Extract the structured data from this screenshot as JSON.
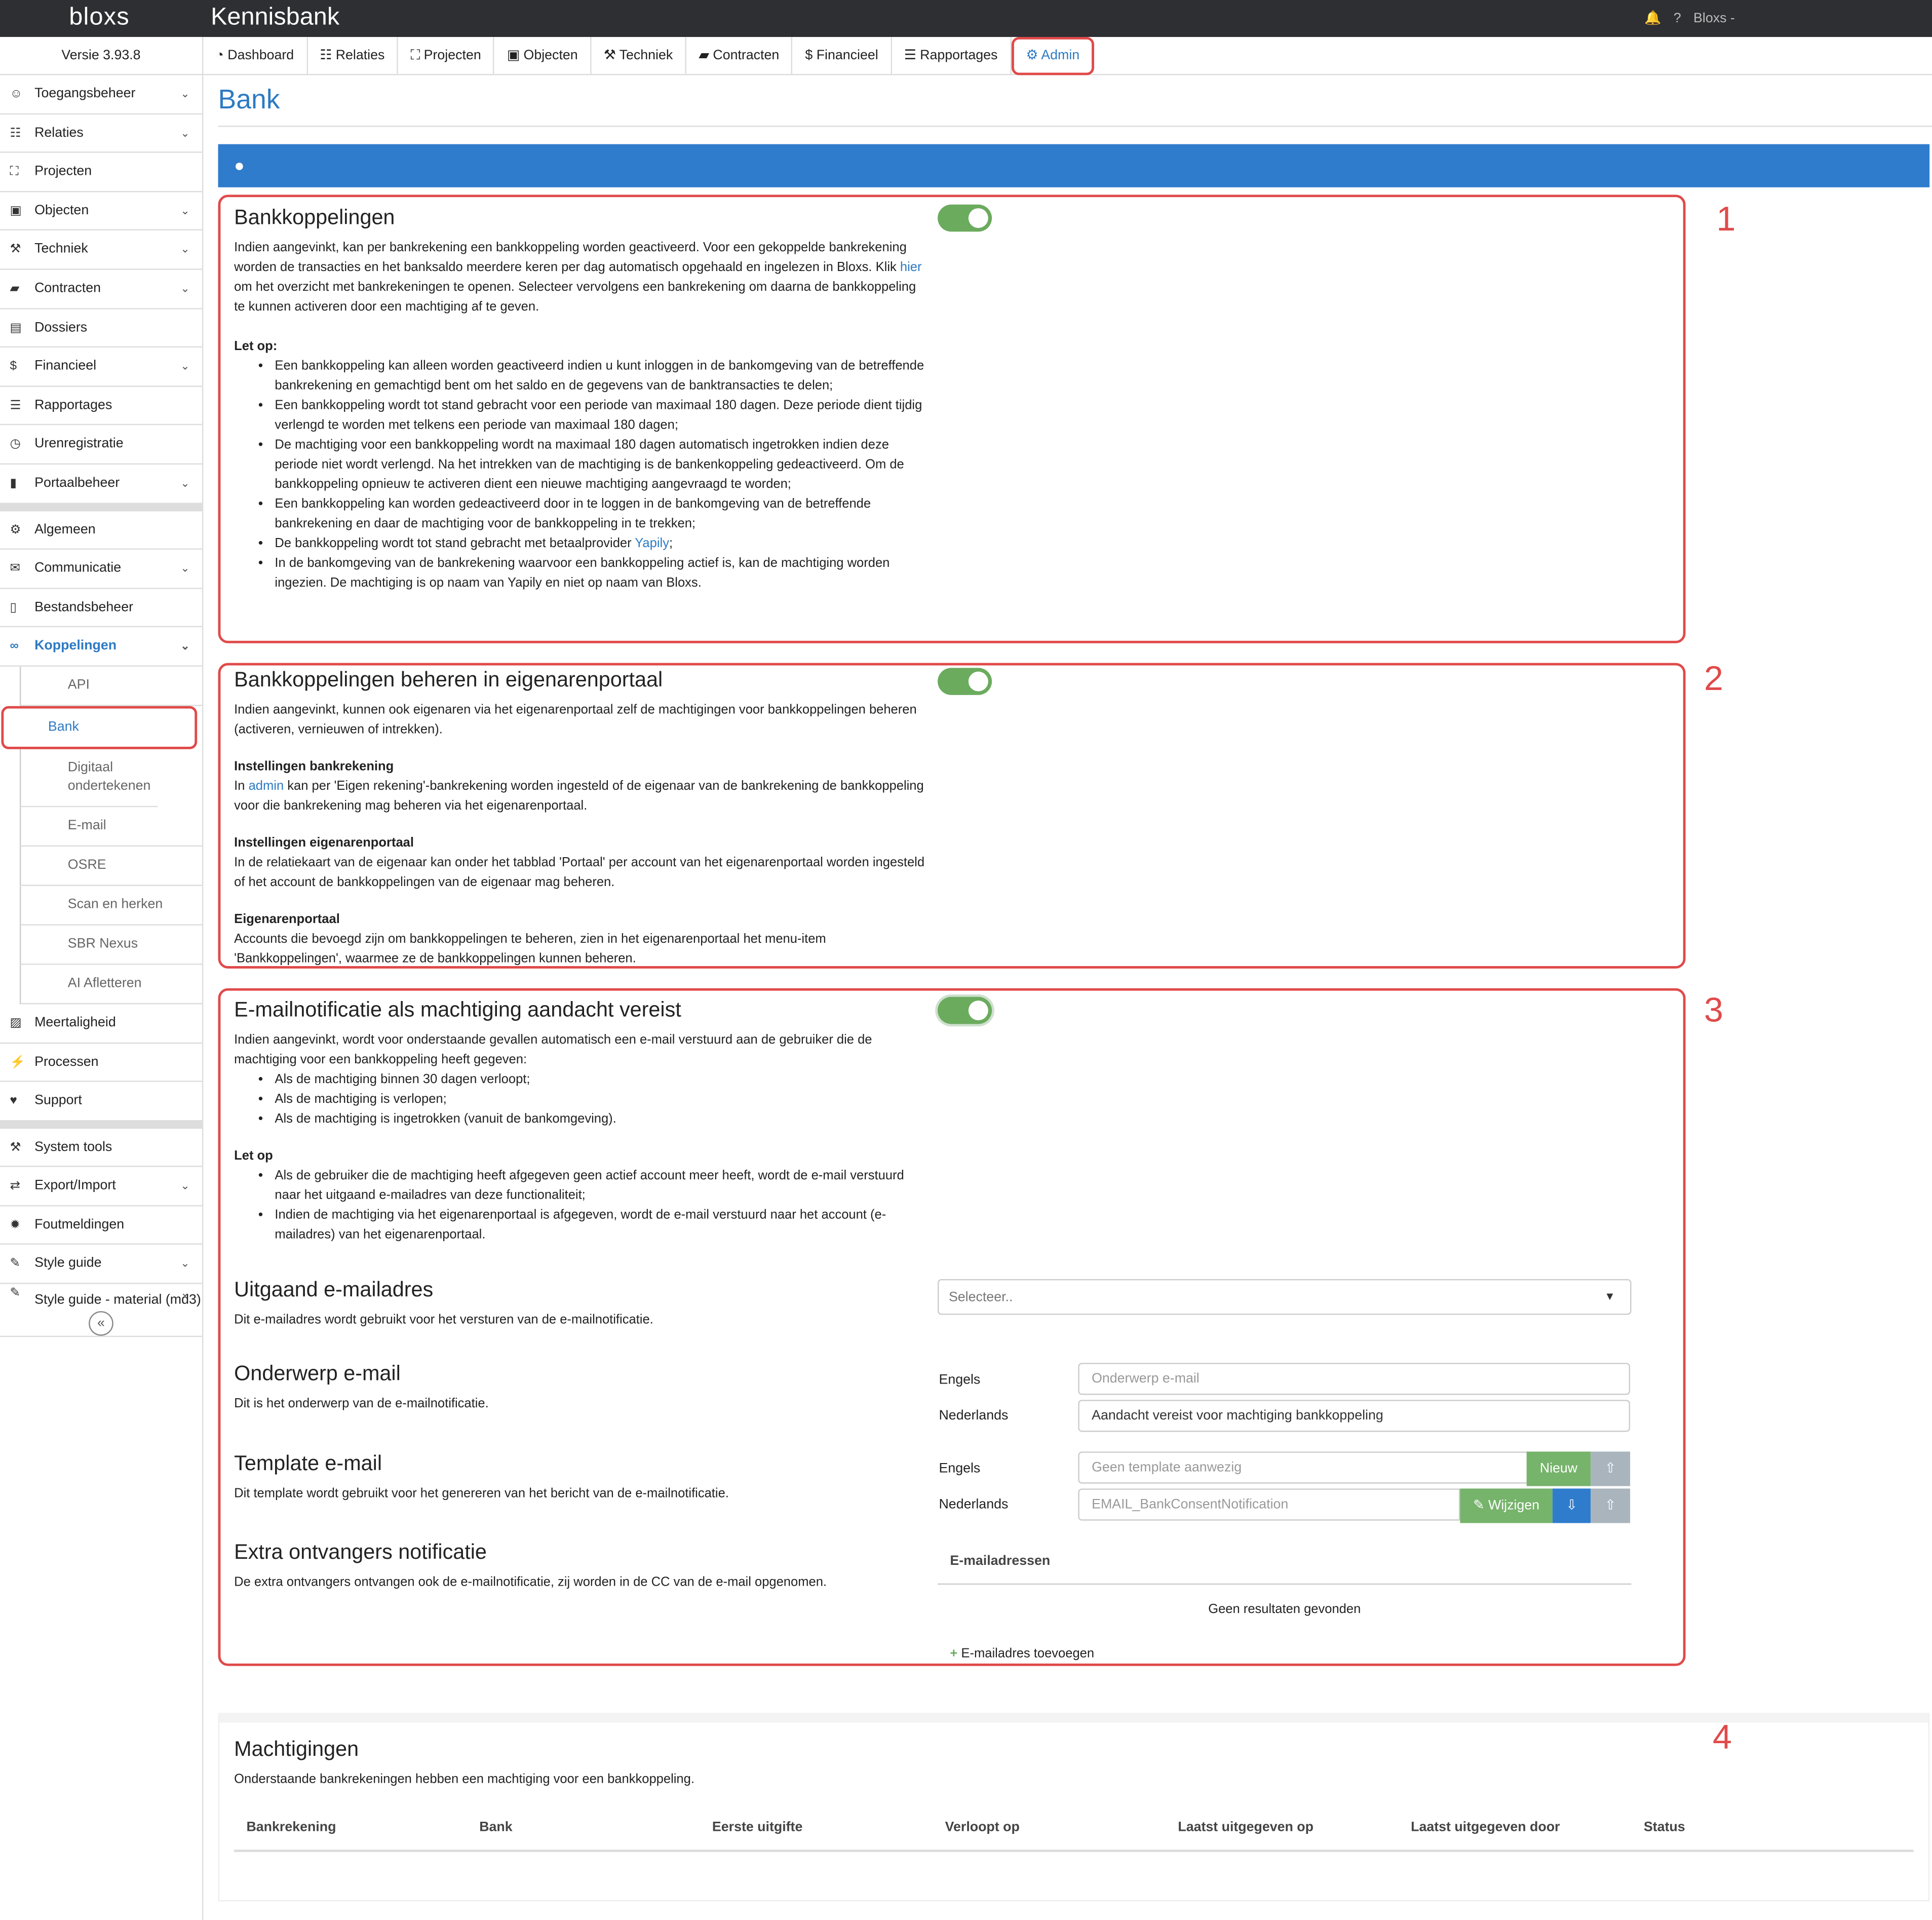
{
  "header": {
    "logo": "bloxs",
    "title": "Kennisbank",
    "bell": "bell-icon",
    "help": "?",
    "user": "Bloxs -"
  },
  "sidebar": {
    "version": "Versie 3.93.8",
    "items": [
      {
        "label": "Toegangsbeheer",
        "icon": "users-icon",
        "chevron": true
      },
      {
        "label": "Relaties",
        "icon": "sitemap-icon",
        "chevron": true
      },
      {
        "label": "Projecten",
        "icon": "expand-icon",
        "chevron": false
      },
      {
        "label": "Objecten",
        "icon": "image-icon",
        "chevron": true
      },
      {
        "label": "Techniek",
        "icon": "tools-icon",
        "chevron": true
      },
      {
        "label": "Contracten",
        "icon": "folder-icon",
        "chevron": true
      },
      {
        "label": "Dossiers",
        "icon": "archive-icon",
        "chevron": false
      },
      {
        "label": "Financieel",
        "icon": "dollar-icon",
        "chevron": true
      },
      {
        "label": "Rapportages",
        "icon": "list-icon",
        "chevron": false
      },
      {
        "label": "Urenregistratie",
        "icon": "clock-icon",
        "chevron": false
      },
      {
        "label": "Portaalbeheer",
        "icon": "bookmark-icon",
        "chevron": true
      }
    ],
    "items2": [
      {
        "label": "Algemeen",
        "icon": "gear-icon",
        "chevron": false
      },
      {
        "label": "Communicatie",
        "icon": "envelope-icon",
        "chevron": true
      },
      {
        "label": "Bestandsbeheer",
        "icon": "file-icon",
        "chevron": false
      },
      {
        "label": "Koppelingen",
        "icon": "link-icon",
        "chevron": true
      }
    ],
    "subitems": [
      "API",
      "Bank",
      "Digitaal ondertekenen",
      "E-mail",
      "OSRE",
      "Scan en herken",
      "SBR Nexus",
      "AI Afletteren"
    ],
    "items3": [
      {
        "label": "Meertaligheid",
        "icon": "language-icon",
        "chevron": false
      },
      {
        "label": "Processen",
        "icon": "bolt-icon",
        "chevron": false
      },
      {
        "label": "Support",
        "icon": "heart-icon",
        "chevron": false
      }
    ],
    "items4": [
      {
        "label": "System tools",
        "icon": "tools-icon",
        "chevron": false
      },
      {
        "label": "Export/Import",
        "icon": "exchange-icon",
        "chevron": true
      },
      {
        "label": "Foutmeldingen",
        "icon": "bug-icon",
        "chevron": false
      },
      {
        "label": "Style guide",
        "icon": "brush-icon",
        "chevron": true
      },
      {
        "label": "Style guide - material (md3)",
        "icon": "brush-icon",
        "chevron": true
      }
    ],
    "collapse": "«"
  },
  "tabs": [
    "Dashboard",
    "Relaties",
    "Projecten",
    "Objecten",
    "Techniek",
    "Contracten",
    "Financieel",
    "Rapportages",
    "Admin"
  ],
  "tab_icons": [
    "dashboard-icon",
    "sitemap-icon",
    "expand-icon",
    "image-icon",
    "tools-icon",
    "folder-icon",
    "dollar-icon",
    "list-icon",
    "gear-icon"
  ],
  "page_title": "Bank",
  "bar_icon": "piggy-bank-icon",
  "annotations": [
    "1",
    "2",
    "3",
    "4"
  ],
  "s1": {
    "title": "Bankkoppelingen",
    "toggle": "on",
    "p1a": "Indien aangevinkt, kan per bankrekening een bankkoppeling worden geactiveerd. Voor een gekoppelde bankrekening worden de transacties en het banksaldo meerdere keren per dag automatisch opgehaald en ingelezen in Bloxs. Klik ",
    "p1link": "hier",
    "p1b": " om het overzicht met bankrekeningen te openen. Selecteer vervolgens een bankrekening om daarna de bankkoppeling te kunnen activeren door een machtiging af te geven.",
    "letop": "Let op:",
    "b1": "Een bankkoppeling kan alleen worden geactiveerd indien u kunt inloggen in de bankomgeving van de betreffende bankrekening en gemachtigd bent om het saldo en de gegevens van de banktransacties te delen;",
    "b2": "Een bankkoppeling wordt tot stand gebracht voor een periode van maximaal 180 dagen. Deze periode dient tijdig verlengd te worden met telkens een periode van maximaal 180 dagen;",
    "b3": "De machtiging voor een bankkoppeling wordt na maximaal 180 dagen automatisch ingetrokken indien deze periode niet wordt verlengd. Na het intrekken van de machtiging is de bankenkoppeling gedeactiveerd. Om de bankkoppeling opnieuw te activeren dient een nieuwe machtiging aangevraagd te worden;",
    "b4": "Een bankkoppeling kan worden gedeactiveerd door in te loggen in de bankomgeving van de betreffende bankrekening en daar de machtiging voor de bankkoppeling in te trekken;",
    "b5a": "De bankkoppeling wordt tot stand gebracht met betaalprovider ",
    "b5link": "Yapily",
    "b5b": ";",
    "b6": "In de bankomgeving van de bankrekening waarvoor een bankkoppeling actief is, kan de machtiging worden ingezien. De machtiging is op naam van Yapily en niet op naam van Bloxs."
  },
  "s2": {
    "title": "Bankkoppelingen beheren in eigenarenportaal",
    "toggle": "on",
    "p1": "Indien aangevinkt, kunnen ook eigenaren via het eigenarenportaal zelf de machtigingen voor bankkoppelingen beheren (activeren, vernieuwen of intrekken).",
    "h1": "Instellingen bankrekening",
    "p2a": "In ",
    "p2link": "admin",
    "p2b": " kan per 'Eigen rekening'-bankrekening worden ingesteld of de eigenaar van de bankrekening de bankkoppeling voor die bankrekening mag beheren via het eigenarenportaal.",
    "h2": "Instellingen eigenarenportaal",
    "p3": "In de relatiekaart van de eigenaar kan onder het tabblad 'Portaal' per account van het eigenarenportaal worden ingesteld of het account de bankkoppelingen van de eigenaar mag beheren.",
    "h3": "Eigenarenportaal",
    "p4": "Accounts die bevoegd zijn om bankkoppelingen te beheren, zien in het eigenarenportaal het menu-item 'Bankkoppelingen', waarmee ze de bankkoppelingen kunnen beheren."
  },
  "s3": {
    "title": "E-mailnotificatie als machtiging aandacht vereist",
    "toggle": "on",
    "p1": "Indien aangevinkt, wordt voor onderstaande gevallen automatisch een e-mail verstuurd aan de gebruiker die de machtiging voor een bankkoppeling heeft gegeven:",
    "b1": "Als de machtiging binnen 30 dagen verloopt;",
    "b2": "Als de machtiging is verlopen;",
    "b3": "Als de machtiging is ingetrokken (vanuit de bankomgeving).",
    "letop": "Let op",
    "b4": "Als de gebruiker die de machtiging heeft afgegeven geen actief account meer heeft, wordt de e-mail verstuurd naar het uitgaand e-mailadres van deze functionaliteit;",
    "b5": "Indien de machtiging via het eigenarenportaal is afgegeven, wordt de e-mail verstuurd naar het account (e-mailadres) van het eigenarenportaal.",
    "out_title": "Uitgaand e-mailadres",
    "out_desc": "Dit e-mailadres wordt gebruikt voor het versturen van de e-mailnotificatie.",
    "out_select": "Selecteer..",
    "subj_title": "Onderwerp e-mail",
    "subj_desc": "Dit is het onderwerp van de e-mailnotificatie.",
    "lang_en": "Engels",
    "lang_nl": "Nederlands",
    "subj_en_placeholder": "Onderwerp e-mail",
    "subj_nl_value": "Aandacht vereist voor machtiging bankkoppeling",
    "tpl_title": "Template e-mail",
    "tpl_desc": "Dit template wordt gebruikt voor het genereren van het bericht van de e-mailnotificatie.",
    "tpl_en_placeholder": "Geen template aanwezig",
    "tpl_new": "Nieuw",
    "tpl_nl_value": "EMAIL_BankConsentNotification",
    "tpl_edit": "Wijzigen",
    "extra_title": "Extra ontvangers notificatie",
    "extra_desc": "De extra ontvangers ontvangen ook de e-mailnotificatie, zij worden in de CC van de e-mail opgenomen.",
    "extra_header": "E-mailadressen",
    "extra_empty": "Geen resultaten gevonden",
    "extra_add": "E-mailadres toevoegen"
  },
  "s4": {
    "title": "Machtigingen",
    "desc": "Onderstaande bankrekeningen hebben een machtiging voor een bankkoppeling.",
    "columns": [
      "Bankrekening",
      "Bank",
      "Eerste uitgifte",
      "Verloopt op",
      "Laatst uitgegeven op",
      "Laatst uitgegeven door",
      "Status"
    ]
  }
}
